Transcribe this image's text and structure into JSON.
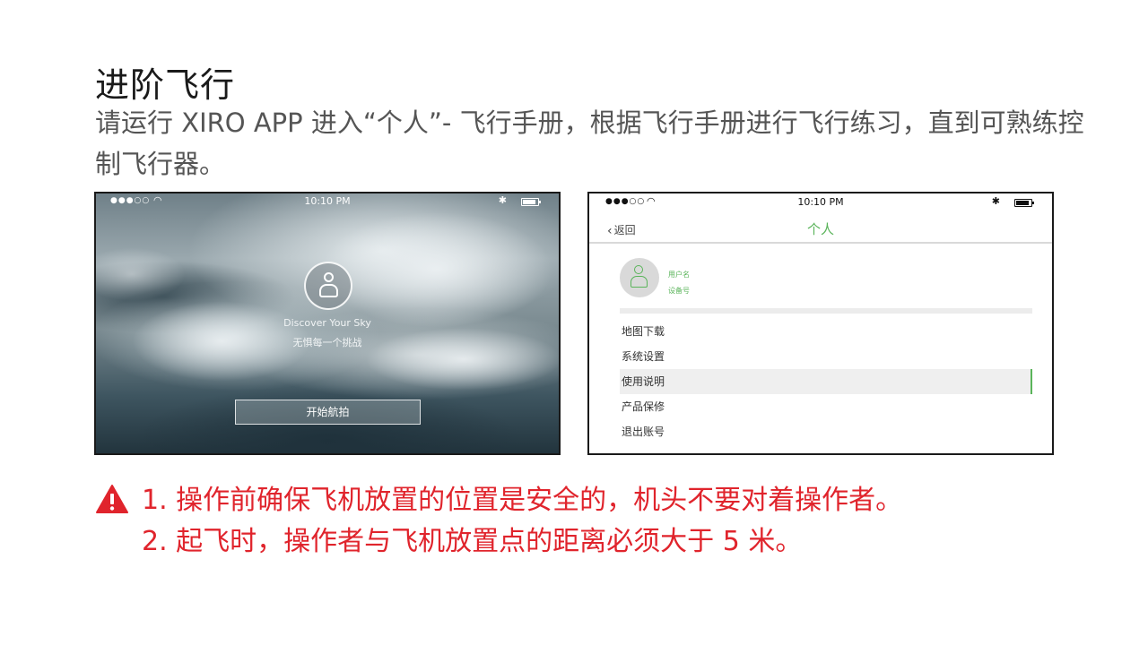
{
  "title": "进阶飞行",
  "description": "请运行 XIRO APP 进入“个人”- 飞行手册，根据飞行手册进行飞行练习，直到可熟练控制飞行器。",
  "left_screen": {
    "status": {
      "time": "10:10 PM"
    },
    "tagline": "Discover Your Sky",
    "sub_tagline": "无惧每一个挑战",
    "start_button": "开始航拍"
  },
  "right_screen": {
    "status": {
      "time": "10:10 PM"
    },
    "back_label": "返回",
    "nav_title": "个人",
    "profile": {
      "username": "用户名",
      "device_id": "设备号"
    },
    "menu": [
      {
        "label": "地图下载",
        "active": false
      },
      {
        "label": "系统设置",
        "active": false
      },
      {
        "label": "使用说明",
        "active": true
      },
      {
        "label": "产品保修",
        "active": false
      },
      {
        "label": "退出账号",
        "active": false
      }
    ]
  },
  "warnings": [
    "1. 操作前确保飞机放置的位置是安全的，机头不要对着操作者。",
    "2. 起飞时，操作者与飞机放置点的距离必须大于 5 米。"
  ],
  "colors": {
    "accent_green": "#5ab45a",
    "warning_red": "#e0242c"
  },
  "icons": [
    "warning-icon",
    "avatar-icon",
    "wifi-icon",
    "bluetooth-icon",
    "battery-icon",
    "back-chevron-icon"
  ]
}
